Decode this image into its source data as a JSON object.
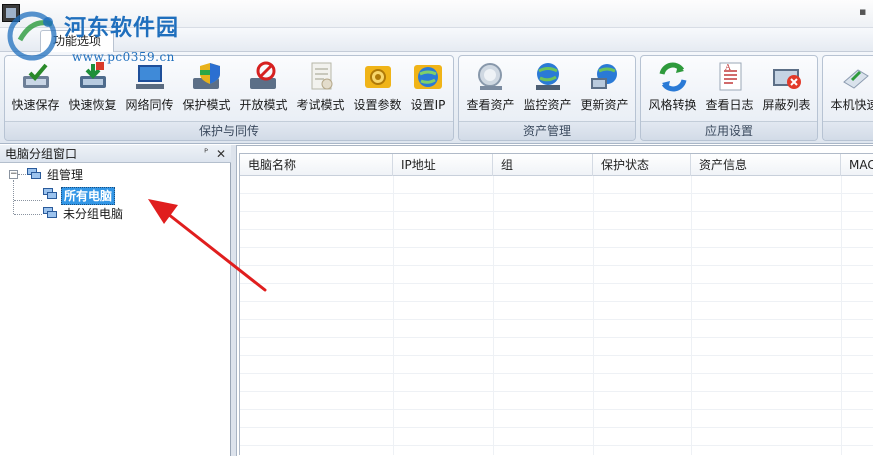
{
  "watermark": {
    "site_name": "河东软件园",
    "url": "www.pc0359.cn"
  },
  "menu": {
    "tab_label": "功能选项"
  },
  "ribbon": {
    "groups": [
      {
        "label": "保护与同传",
        "buttons": [
          {
            "label": "快速保存",
            "icon": "quick-save-icon"
          },
          {
            "label": "快速恢复",
            "icon": "quick-restore-icon"
          },
          {
            "label": "网络同传",
            "icon": "network-transfer-icon"
          },
          {
            "label": "保护模式",
            "icon": "protect-mode-icon"
          },
          {
            "label": "开放模式",
            "icon": "open-mode-icon"
          },
          {
            "label": "考试模式",
            "icon": "exam-mode-icon"
          },
          {
            "label": "设置参数",
            "icon": "settings-gear-icon"
          },
          {
            "label": "设置IP",
            "icon": "set-ip-globe-icon"
          }
        ]
      },
      {
        "label": "资产管理",
        "buttons": [
          {
            "label": "查看资产",
            "icon": "view-assets-icon"
          },
          {
            "label": "监控资产",
            "icon": "monitor-assets-icon"
          },
          {
            "label": "更新资产",
            "icon": "update-assets-icon"
          }
        ]
      },
      {
        "label": "应用设置",
        "buttons": [
          {
            "label": "风格转换",
            "icon": "style-switch-icon"
          },
          {
            "label": "查看日志",
            "icon": "view-log-icon"
          },
          {
            "label": "屏蔽列表",
            "icon": "block-list-icon"
          }
        ]
      },
      {
        "label": "",
        "buttons": [
          {
            "label": "本机快速",
            "icon": "local-quick-icon"
          }
        ]
      }
    ]
  },
  "left_panel": {
    "title": "电脑分组窗口",
    "pin_glyph": "ᴾ",
    "close_glyph": "✕",
    "tree": {
      "expander": "−",
      "root_label": "组管理",
      "children": [
        "所有电脑",
        "未分组电脑"
      ]
    }
  },
  "grid": {
    "columns": [
      "电脑名称",
      "IP地址",
      "组",
      "保护状态",
      "资产信息",
      "MAC"
    ]
  },
  "colors": {
    "selection": "#3296e6",
    "arrow": "#e01e1e",
    "watermark": "#1f6fbd"
  }
}
